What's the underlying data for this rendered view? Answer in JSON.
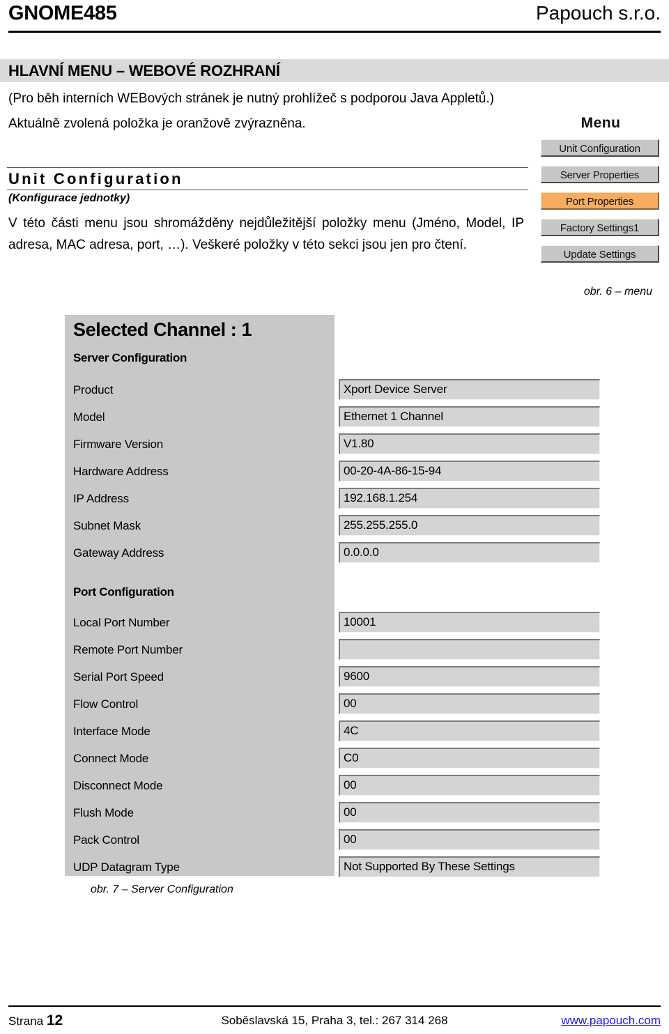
{
  "header": {
    "doc_title": "GNOME485",
    "company": "Papouch s.r.o."
  },
  "section": {
    "band_title": "HLAVNÍ MENU – WEBOVÉ ROZHRANÍ",
    "intro_line_1": "(Pro běh interních WEBových stránek je nutný prohlížeč s podporou Java Appletů.)",
    "intro_line_2": "Aktuálně zvolená položka je oranžově zvýrazněna."
  },
  "unit": {
    "heading": "Unit Configuration",
    "subheading": "(Konfigurace jednotky)",
    "body": "V této části menu jsou shromážděny nejdůležitější položky menu (Jméno, Model, IP adresa, MAC adresa, port, …). Veškeré položky v této sekci jsou",
    "body_last": "jen pro čtení."
  },
  "menu": {
    "title": "Menu",
    "selected": "Port Properties",
    "accent_color": "#f7ac5f",
    "items": [
      {
        "label": "Unit Configuration",
        "selected": false
      },
      {
        "label": "Server Properties",
        "selected": false
      },
      {
        "label": "Port Properties",
        "selected": true
      },
      {
        "label": "Factory Settings1",
        "selected": false
      },
      {
        "label": "Update Settings",
        "selected": false
      }
    ]
  },
  "captions": {
    "fig6": "obr. 6 – menu",
    "fig7": "obr. 7 – Server Configuration"
  },
  "figure": {
    "title": "Selected Channel : 1",
    "server_section_title": "Server Configuration",
    "server_rows": [
      {
        "label": "Product",
        "value": "Xport Device Server"
      },
      {
        "label": "Model",
        "value": "Ethernet 1 Channel"
      },
      {
        "label": "Firmware Version",
        "value": "V1.80"
      },
      {
        "label": "Hardware Address",
        "value": "00-20-4A-86-15-94"
      },
      {
        "label": "IP Address",
        "value": "192.168.1.254"
      },
      {
        "label": "Subnet Mask",
        "value": "255.255.255.0"
      },
      {
        "label": "Gateway Address",
        "value": "0.0.0.0"
      }
    ],
    "port_section_title": "Port Configuration",
    "port_rows": [
      {
        "label": "Local Port Number",
        "value": "10001"
      },
      {
        "label": "Remote Port Number",
        "value": ""
      },
      {
        "label": "Serial Port Speed",
        "value": "9600"
      },
      {
        "label": "Flow Control",
        "value": "00"
      },
      {
        "label": "Interface Mode",
        "value": "4C"
      },
      {
        "label": "Connect Mode",
        "value": "C0"
      },
      {
        "label": "Disconnect Mode",
        "value": "00"
      },
      {
        "label": "Flush Mode",
        "value": "00"
      },
      {
        "label": "Pack Control",
        "value": "00"
      },
      {
        "label": "UDP Datagram Type",
        "value": "Not Supported By These Settings"
      }
    ]
  },
  "footer": {
    "page_label": "Strana",
    "page_number": "12",
    "address": "Soběslavská 15, Praha 3, tel.: 267 314 268",
    "website": "www.papouch.com"
  }
}
